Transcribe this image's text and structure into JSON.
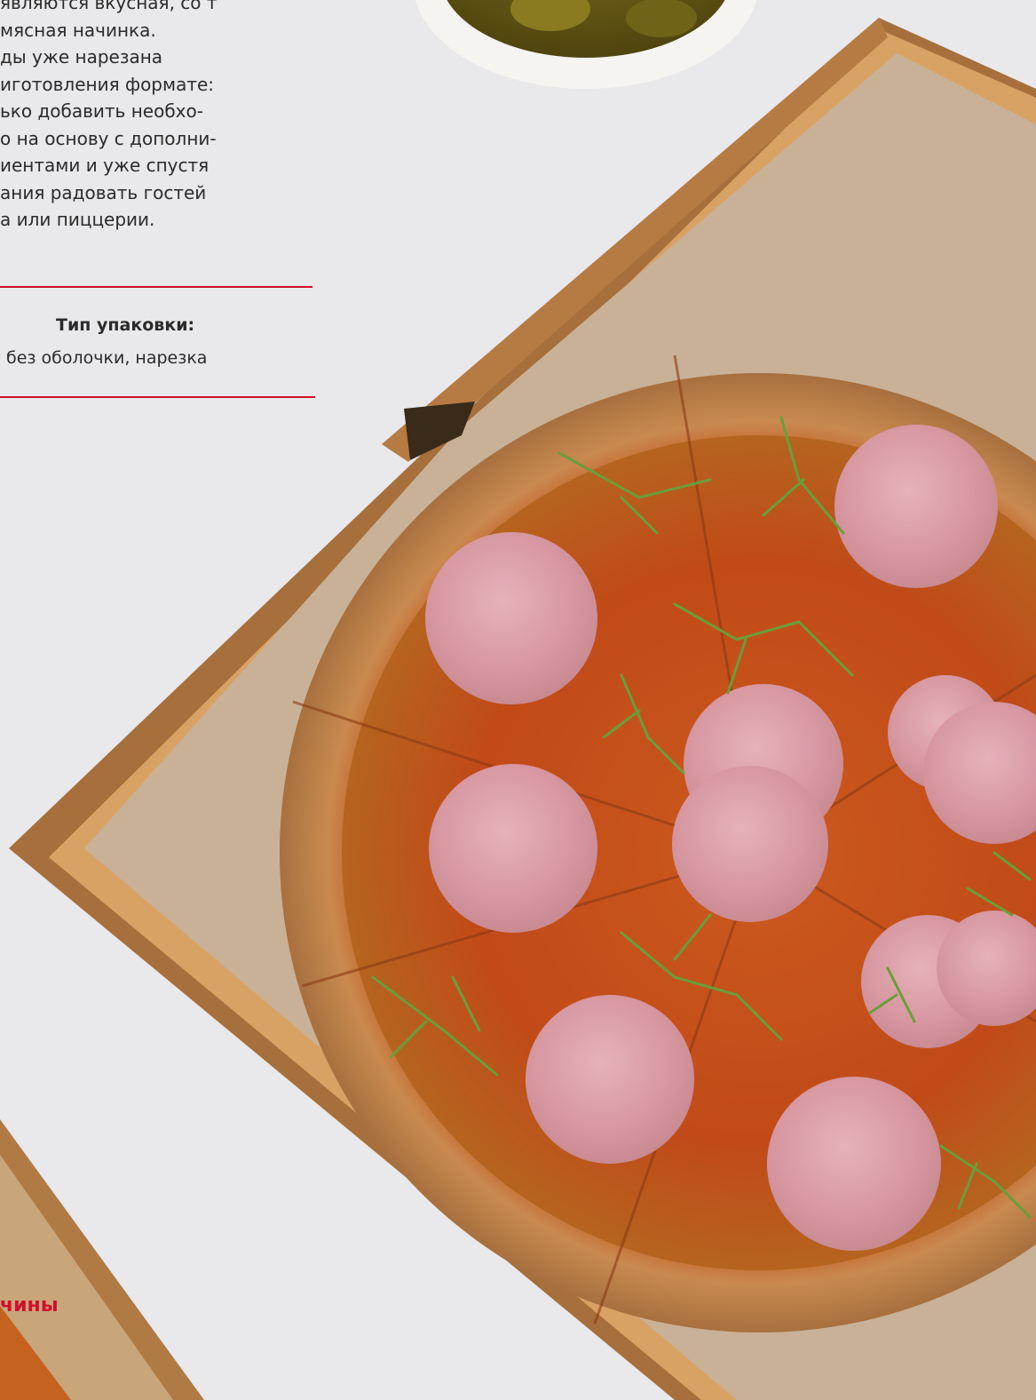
{
  "description": {
    "lines": [
      "являются вкусная, со т",
      "мясная начинка.",
      "ды уже нарезана",
      "иготовления формате:",
      "ько добавить необхо-",
      "о на основу с дополни-",
      "иентами и уже спустя",
      "ания радовать гостей",
      "а или пиццерии."
    ]
  },
  "packaging": {
    "label": "Тип упаковки:",
    "value": "без оболочки, нарезка"
  },
  "bottom_heading": "чины",
  "colors": {
    "accent": "#d0102b",
    "text": "#2b2b2b",
    "background": "#e9e8ea",
    "box": "#b07a45",
    "paper": "#c9b197",
    "crust": "#c98a4f",
    "sauce": "#c5531f",
    "ham": "#d89aa3",
    "herbs": "#6a9e3a"
  },
  "photo": {
    "subject": "pizza-with-ham-and-microgreens-in-box",
    "side_dish": "pickled-jalapenos-bowl"
  }
}
